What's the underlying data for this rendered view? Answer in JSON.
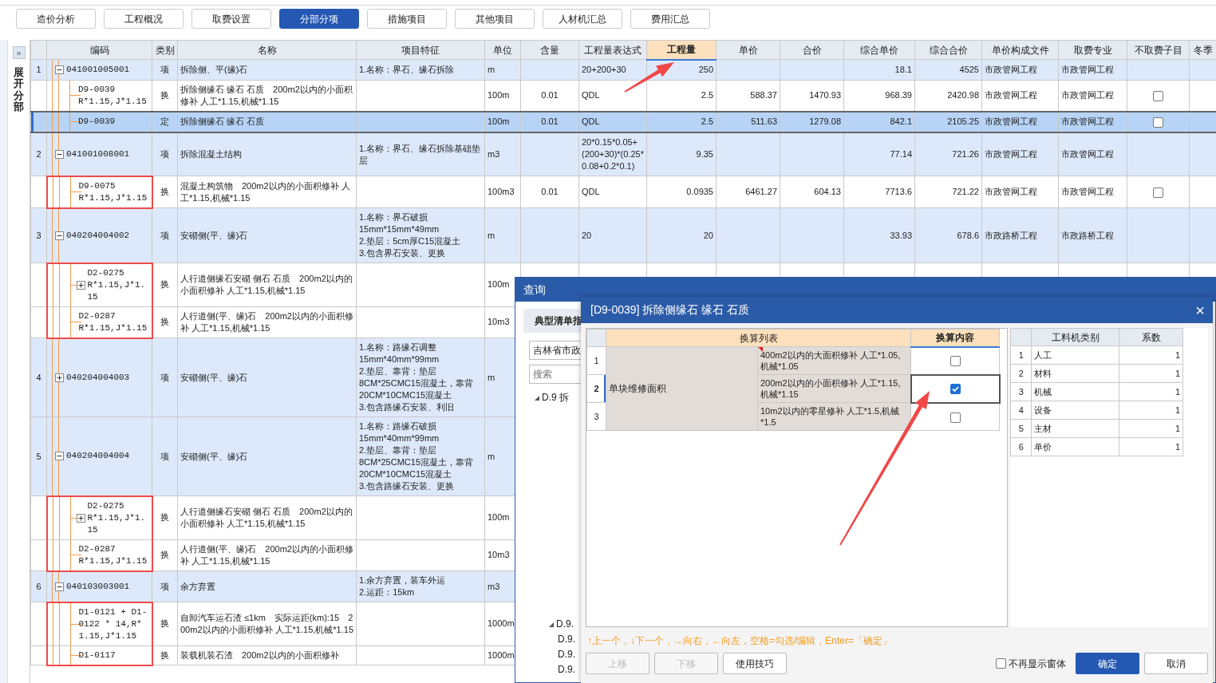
{
  "tabs": [
    {
      "label": "造价分析",
      "selected": false
    },
    {
      "label": "工程概况",
      "selected": false
    },
    {
      "label": "取费设置",
      "selected": false
    },
    {
      "label": "分部分项",
      "selected": true
    },
    {
      "label": "措施项目",
      "selected": false
    },
    {
      "label": "其他项目",
      "selected": false
    },
    {
      "label": "人材机汇总",
      "selected": false
    },
    {
      "label": "费用汇总",
      "selected": false
    }
  ],
  "side_panel": {
    "toggle": "»",
    "label": "展开分部"
  },
  "table": {
    "columns": [
      {
        "label": "编码",
        "selected": false
      },
      {
        "label": "类别",
        "selected": false
      },
      {
        "label": "名称",
        "selected": false
      },
      {
        "label": "项目特征",
        "selected": false
      },
      {
        "label": "单位",
        "selected": false
      },
      {
        "label": "含量",
        "selected": false
      },
      {
        "label": "工程量表达式",
        "selected": false
      },
      {
        "label": "工程量",
        "selected": true
      },
      {
        "label": "单价",
        "selected": false
      },
      {
        "label": "合价",
        "selected": false
      },
      {
        "label": "综合单价",
        "selected": false
      },
      {
        "label": "综合合价",
        "selected": false
      },
      {
        "label": "单价构成文件",
        "selected": false
      },
      {
        "label": "取费专业",
        "selected": false
      },
      {
        "label": "不取费子目",
        "selected": false
      },
      {
        "label": "冬季",
        "selected": false
      }
    ],
    "rows": [
      {
        "kind": "item",
        "number": "1",
        "expanded": true,
        "code": "041001005001",
        "type": "项",
        "name": "拆除侧、平(缘)石",
        "feature": "1.名称：界石、缘石拆除",
        "unit": "m",
        "expr": "20+200+30",
        "qty": "250",
        "comp_price": "18.1",
        "comp_total": "4525",
        "file": "市政管网工程",
        "fee": "市政管网工程",
        "selected": false,
        "annotated": false
      },
      {
        "kind": "sub",
        "code": "D9-0039\nR*1.15,J*1.15",
        "type": "换",
        "name": "拆除侧缘石 缘石 石质　200m2以内的小面积修补 人工*1.15,机械*1.15",
        "unit": "100m",
        "content": "0.01",
        "expr": "QDL",
        "qty": "2.5",
        "price": "588.37",
        "total": "1470.93",
        "comp_price": "968.39",
        "comp_total": "2420.98",
        "file": "市政管网工程",
        "fee": "市政管网工程",
        "no_fee": false,
        "selected": false,
        "annotated": false
      },
      {
        "kind": "sub",
        "code": "D9-0039",
        "type": "定",
        "name": "拆除侧缘石 缘石 石质",
        "unit": "100m",
        "content": "0.01",
        "expr": "QDL",
        "qty": "2.5",
        "price": "511.63",
        "total": "1279.08",
        "comp_price": "842.1",
        "comp_total": "2105.25",
        "file": "市政管网工程",
        "fee": "市政管网工程",
        "no_fee": false,
        "selected": true,
        "annotated": false
      },
      {
        "kind": "item",
        "number": "2",
        "expanded": true,
        "code": "041001008001",
        "type": "项",
        "name": "拆除混凝土结构",
        "feature": "1.名称：界石、缘石拆除基础垫层",
        "unit": "m3",
        "expr": "20*0.15*0.05+(200+30)*(0.25*0.08+0.2*0.1)",
        "qty": "9.35",
        "comp_price": "77.14",
        "comp_total": "721.26",
        "file": "市政管网工程",
        "fee": "市政管网工程",
        "selected": false,
        "annotated": false
      },
      {
        "kind": "sub",
        "code": "D9-0075\nR*1.15,J*1.15",
        "type": "换",
        "name": "混凝土构筑物　200m2以内的小面积修补 人工*1.15,机械*1.15",
        "unit": "100m3",
        "content": "0.01",
        "expr": "QDL",
        "qty": "0.0935",
        "price": "6461.27",
        "total": "604.13",
        "comp_price": "7713.6",
        "comp_total": "721.22",
        "file": "市政管网工程",
        "fee": "市政管网工程",
        "no_fee": false,
        "selected": false,
        "annotated": true
      },
      {
        "kind": "item",
        "number": "3",
        "expanded": true,
        "code": "040204004002",
        "type": "项",
        "name": "安砌侧(平、缘)石",
        "feature": "1.名称：界石破损\n15mm*15mm*49mm\n2.垫层：5cm厚C15混凝土\n3.包含界石安装、更换",
        "unit": "m",
        "expr": "20",
        "qty": "20",
        "comp_price": "33.93",
        "comp_total": "678.6",
        "file": "市政路桥工程",
        "fee": "市政路桥工程",
        "selected": false,
        "annotated": false
      },
      {
        "kind": "sub",
        "expanded": false,
        "code": "D2-0275\nR*1.15,J*1.15",
        "type": "换",
        "name": "人行道侧缘石安砌 侧石 石质　200m2以内的小面积修补 人工*1.15,机械*1.15",
        "unit": "100m",
        "selected": false,
        "annotated": true
      },
      {
        "kind": "sub",
        "code": "D2-0287\nR*1.15,J*1.15",
        "type": "换",
        "name": "人行道侧(平、缘)石　200m2以内的小面积修补 人工*1.15,机械*1.15",
        "unit": "10m3",
        "selected": false,
        "annotated": true
      },
      {
        "kind": "item",
        "number": "4",
        "expanded": false,
        "code": "040204004003",
        "type": "项",
        "name": "安砌侧(平、缘)石",
        "feature": "1.名称：路缘石调整\n15mm*40mm*99mm\n2.垫层、靠背：垫层\n8CM*25CMC15混凝土，靠背\n20CM*10CMC15混凝土\n3.包含路缘石安装、利旧",
        "unit": "m",
        "selected": false,
        "annotated": false
      },
      {
        "kind": "item",
        "number": "5",
        "expanded": true,
        "code": "040204004004",
        "type": "项",
        "name": "安砌侧(平、缘)石",
        "feature": "1.名称：路缘石破损\n15mm*40mm*99mm\n2.垫层、靠背：垫层\n8CM*25CMC15混凝土，靠背\n20CM*10CMC15混凝土\n3.包含路缘石安装、更换",
        "unit": "m",
        "selected": false,
        "annotated": false
      },
      {
        "kind": "sub",
        "expanded": false,
        "code": "D2-0275\nR*1.15,J*1.15",
        "type": "换",
        "name": "人行道侧缘石安砌 侧石 石质　200m2以内的小面积修补 人工*1.15,机械*1.15",
        "unit": "100m",
        "selected": false,
        "annotated": true
      },
      {
        "kind": "sub",
        "code": "D2-0287\nR*1.15,J*1.15",
        "type": "换",
        "name": "人行道侧(平、缘)石　200m2以内的小面积修补 人工*1.15,机械*1.15",
        "unit": "10m3",
        "selected": false,
        "annotated": true
      },
      {
        "kind": "item",
        "number": "6",
        "expanded": true,
        "code": "040103003001",
        "type": "项",
        "name": "余方弃置",
        "feature": "1.余方弃置，装车外运\n2.运距：15km",
        "unit": "m3",
        "selected": false,
        "annotated": false
      },
      {
        "kind": "sub",
        "code": "D1-0121 + D1-0122 * 14,R*1.15,J*1.15",
        "type": "换",
        "name": "自卸汽车运石渣 ≤1km　实际运距(km):15　200m2以内的小面积修补 人工*1.15,机械*1.15",
        "unit": "1000m",
        "selected": false,
        "annotated": true
      },
      {
        "kind": "sub",
        "code": "D1-0117",
        "type": "换",
        "name": "装载机装石渣　200m2以内的小面积修补",
        "unit": "1000m",
        "selected": false,
        "annotated": true
      }
    ]
  },
  "query_dialog": {
    "title": "查询",
    "tab": "典型清单指",
    "region": "吉林省市政",
    "search_placeholder": "搜索",
    "tree": [
      {
        "label": "D.9 拆",
        "expanded": true,
        "children": [
          {
            "label": "D.9.",
            "expanded": true
          },
          {
            "label": "D.9.",
            "expanded": false
          },
          {
            "label": "D.9.",
            "expanded": false
          },
          {
            "label": "D.9.",
            "expanded": false
          }
        ]
      }
    ]
  },
  "convert_dialog": {
    "title": "[D9-0039] 拆除侧缘石 缘石 石质",
    "close": "×",
    "columns": [
      {
        "label": "换算列表",
        "selected": false
      },
      {
        "label": "换算内容",
        "selected": true
      }
    ],
    "group": "单块维修面积",
    "options": [
      {
        "number": "1",
        "text": "400m2以内的大面积修补 人工*1.05,机械*1.05",
        "checked": false,
        "selected": false,
        "flagged": true
      },
      {
        "number": "2",
        "text": "200m2以内的小面积修补 人工*1.15,机械*1.15",
        "checked": true,
        "selected": true,
        "flagged": false
      },
      {
        "number": "3",
        "text": "10m2以内的零星修补 人工*1.5,机械*1.5",
        "checked": false,
        "selected": false,
        "flagged": false
      }
    ],
    "factor_columns": [
      "工料机类别",
      "系数"
    ],
    "factors": [
      {
        "number": "1",
        "category": "人工",
        "factor": "1"
      },
      {
        "number": "2",
        "category": "材料",
        "factor": "1"
      },
      {
        "number": "3",
        "category": "机械",
        "factor": "1"
      },
      {
        "number": "4",
        "category": "设备",
        "factor": "1"
      },
      {
        "number": "5",
        "category": "主材",
        "factor": "1"
      },
      {
        "number": "6",
        "category": "单价",
        "factor": "1"
      }
    ],
    "hint": "↑上一个，↓下一个，→向右，←向左，空格=勾选/编辑，Enter=「确定」",
    "buttons": [
      {
        "label": "上移",
        "disabled": true
      },
      {
        "label": "下移",
        "disabled": true
      },
      {
        "label": "使用技巧",
        "disabled": false
      }
    ],
    "dont_show": {
      "label": "不再显示窗体",
      "checked": false
    },
    "ok": "确定",
    "cancel": "取消"
  }
}
